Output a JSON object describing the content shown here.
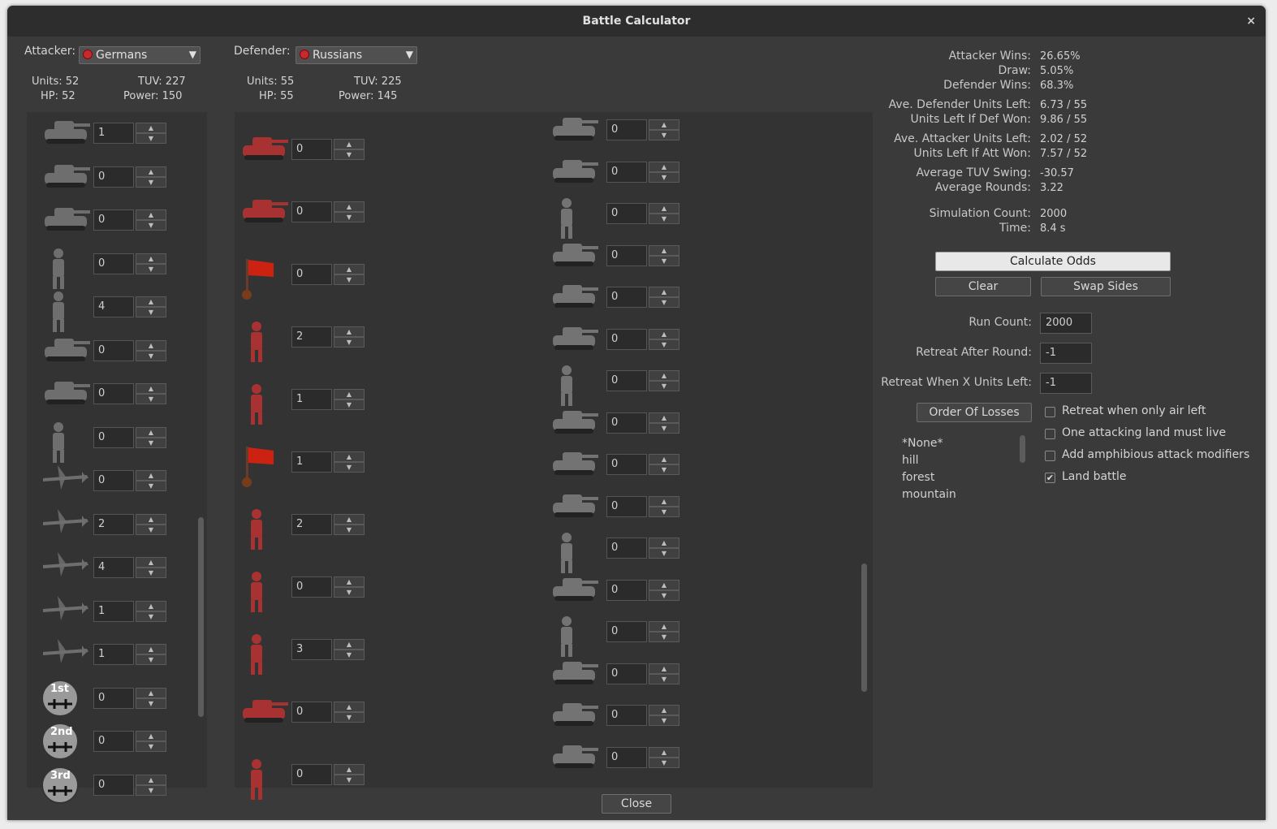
{
  "window": {
    "title": "Battle Calculator",
    "close_glyph": "×"
  },
  "attacker": {
    "label": "Attacker:",
    "selected": "Germans",
    "units": "Units: 52",
    "tuv": "TUV: 227",
    "hp": "HP: 52",
    "power": "Power: 150",
    "rows": [
      {
        "icon": "armored-car-icon",
        "count": "1"
      },
      {
        "icon": "tank-destroyer-icon",
        "count": "0"
      },
      {
        "icon": "landing-craft-icon",
        "count": "0"
      },
      {
        "icon": "paratrooper-icon",
        "count": "0"
      },
      {
        "icon": "infantry-icon",
        "count": "4"
      },
      {
        "icon": "halftrack-icon",
        "count": "0"
      },
      {
        "icon": "rocket-launcher-icon",
        "count": "0"
      },
      {
        "icon": "paratrooper-red-chute-icon",
        "count": "0"
      },
      {
        "icon": "fighter-plane-icon",
        "count": "0"
      },
      {
        "icon": "fighter-plane-icon",
        "count": "2"
      },
      {
        "icon": "fighter-plane-icon",
        "count": "4"
      },
      {
        "icon": "fighter-plane-icon",
        "count": "1"
      },
      {
        "icon": "bomber-plane-icon",
        "count": "1"
      },
      {
        "icon": "1st-air-fleet-icon",
        "count": "0",
        "badge": "1st"
      },
      {
        "icon": "2nd-air-fleet-icon",
        "count": "0",
        "badge": "2nd"
      },
      {
        "icon": "3rd-air-fleet-icon",
        "count": "0",
        "badge": "3rd"
      }
    ]
  },
  "defender": {
    "label": "Defender:",
    "selected": "Russians",
    "units": "Units: 55",
    "tuv": "TUV: 225",
    "hp": "HP: 55",
    "power": "Power: 145",
    "rows": [
      {
        "icon": "tank-icon",
        "count": "0"
      },
      {
        "icon": "tank-icon",
        "count": "0"
      },
      {
        "icon": "soviet-flag-icon",
        "count": "0"
      },
      {
        "icon": "officer-icon",
        "count": "2"
      },
      {
        "icon": "officer-icon",
        "count": "1"
      },
      {
        "icon": "soviet-flag-icon",
        "count": "1"
      },
      {
        "icon": "paratrooper-icon",
        "count": "2"
      },
      {
        "icon": "paratrooper-icon",
        "count": "0"
      },
      {
        "icon": "rifleman-icon",
        "count": "3"
      },
      {
        "icon": "truck-icon",
        "count": "0"
      },
      {
        "icon": "soldier-icon",
        "count": "0"
      }
    ],
    "rows2": [
      {
        "icon": "tank-icon",
        "count": "0"
      },
      {
        "icon": "tank-destroyer-icon",
        "count": "0"
      },
      {
        "icon": "infantry-icon",
        "count": "0"
      },
      {
        "icon": "tank-destroyer-icon",
        "count": "0"
      },
      {
        "icon": "tank-icon",
        "count": "0"
      },
      {
        "icon": "tank-destroyer-icon",
        "count": "0"
      },
      {
        "icon": "infantry-icon",
        "count": "0"
      },
      {
        "icon": "tank-icon",
        "count": "0"
      },
      {
        "icon": "tank-icon",
        "count": "0"
      },
      {
        "icon": "heavy-tank-icon",
        "count": "0"
      },
      {
        "icon": "officer-icon",
        "count": "0"
      },
      {
        "icon": "tank-icon",
        "count": "0"
      },
      {
        "icon": "officer-icon",
        "count": "0"
      },
      {
        "icon": "tank-destroyer-icon",
        "count": "0"
      },
      {
        "icon": "halftrack-icon",
        "count": "0"
      },
      {
        "icon": "tank-destroyer-icon",
        "count": "0"
      }
    ]
  },
  "results": [
    {
      "label": "Attacker Wins:",
      "value": "26.65%"
    },
    {
      "label": "Draw:",
      "value": "5.05%"
    },
    {
      "label": "Defender Wins:",
      "value": "68.3%"
    },
    {
      "label": "Ave. Defender Units Left:",
      "value": "6.73 / 55"
    },
    {
      "label": "Units Left If Def Won:",
      "value": "9.86 / 55"
    },
    {
      "label": "Ave. Attacker Units Left:",
      "value": "2.02 / 52"
    },
    {
      "label": "Units Left If Att Won:",
      "value": "7.57 / 52"
    },
    {
      "label": "Average TUV Swing:",
      "value": "-30.57"
    },
    {
      "label": "Average Rounds:",
      "value": "3.22"
    },
    {
      "label": "Simulation Count:",
      "value": "2000"
    },
    {
      "label": "Time:",
      "value": "8.4 s"
    }
  ],
  "controls": {
    "calculate": "Calculate Odds",
    "clear": "Clear",
    "swap": "Swap Sides",
    "run_count_label": "Run Count:",
    "run_count": "2000",
    "retreat_round_label": "Retreat After Round:",
    "retreat_round": "-1",
    "retreat_units_label": "Retreat When X Units Left:",
    "retreat_units": "-1",
    "order_of_losses": "Order Of Losses",
    "close": "Close"
  },
  "effects": [
    "*None*",
    "hill",
    "forest",
    "mountain"
  ],
  "checkboxes": [
    {
      "label": "Retreat when only air left",
      "checked": false
    },
    {
      "label": "One attacking land must live",
      "checked": false
    },
    {
      "label": "Add amphibious attack modifiers",
      "checked": false
    },
    {
      "label": "Land battle",
      "checked": true
    }
  ],
  "colors": {
    "german_grey": "#6b6b6b",
    "soviet_red": "#a52a2a",
    "window_bg": "#3a3a3a"
  }
}
